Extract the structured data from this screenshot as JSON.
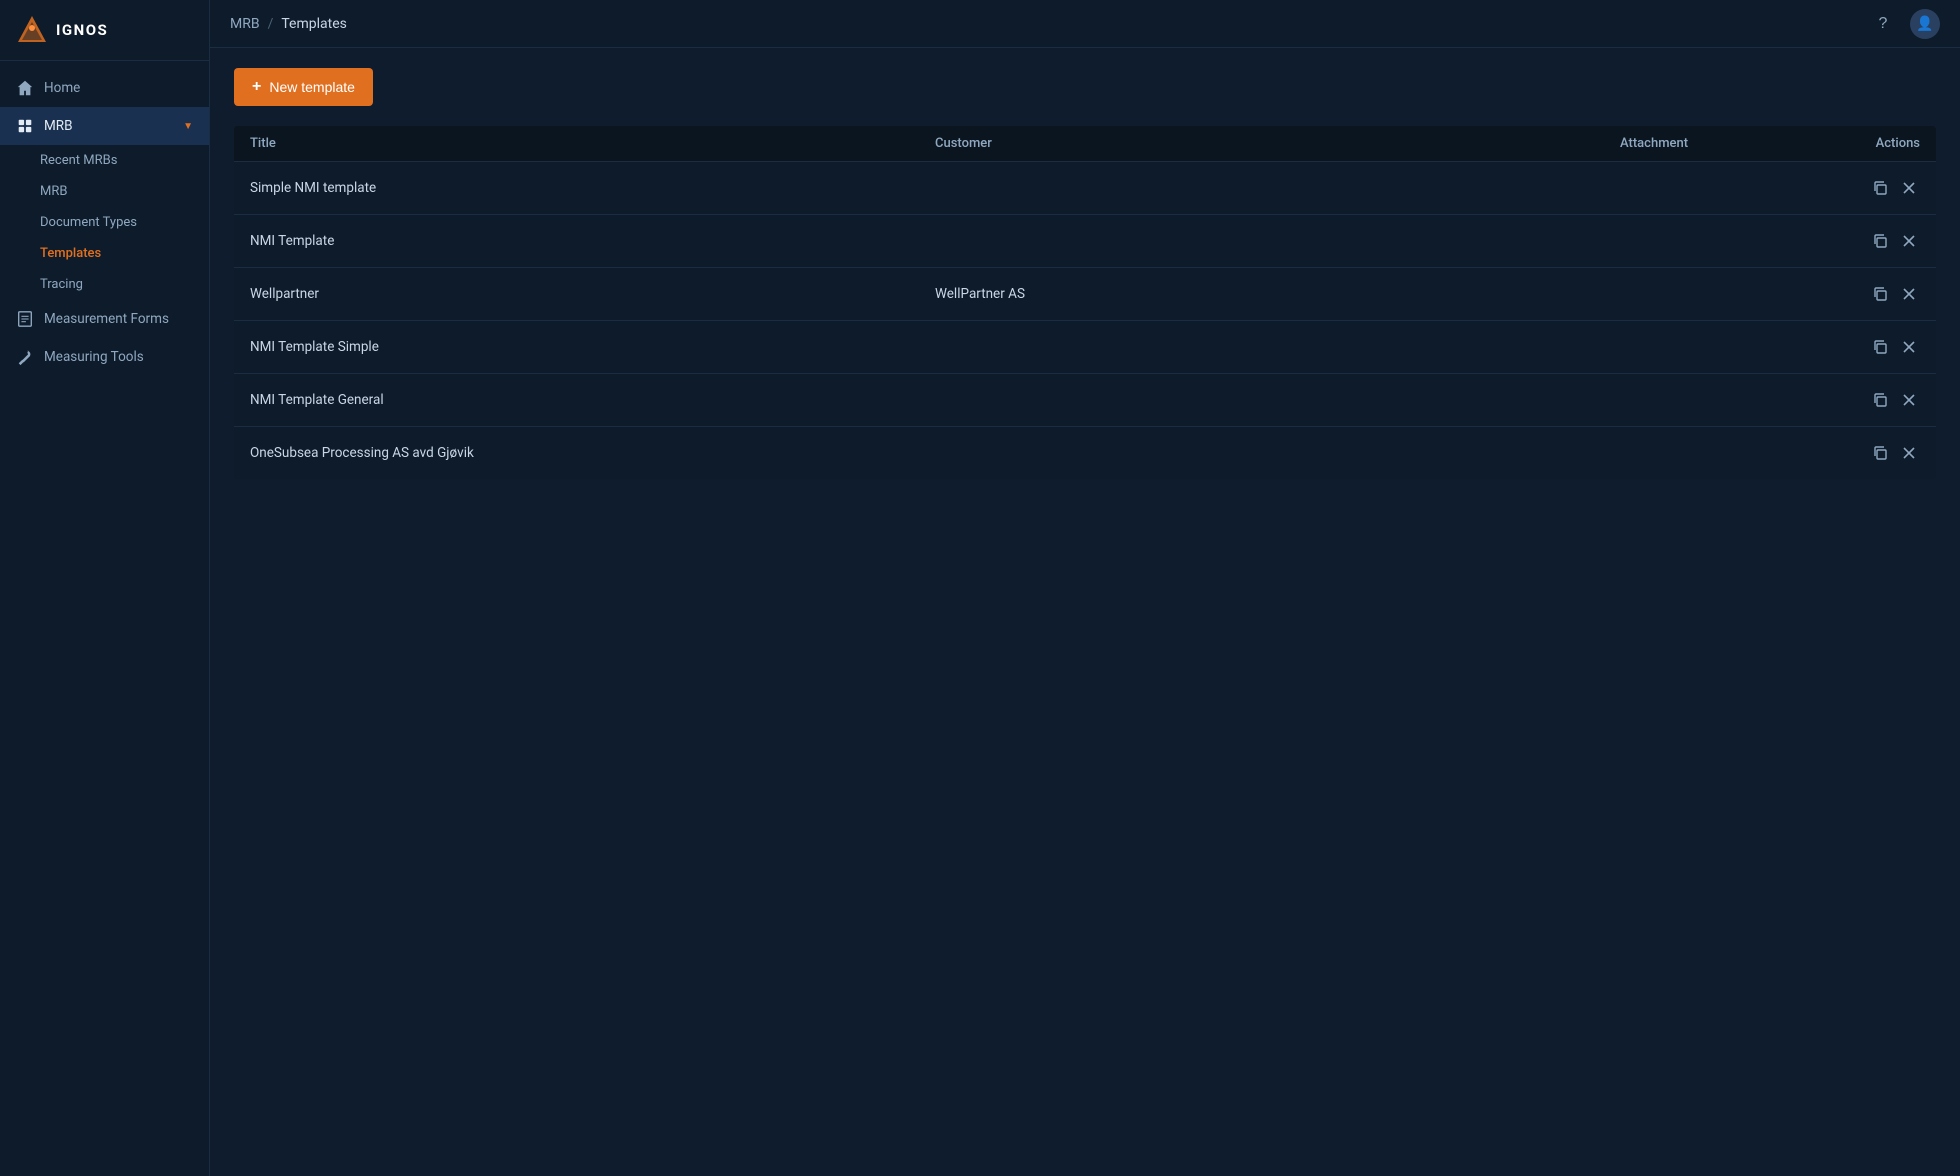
{
  "app": {
    "name": "IGNOS"
  },
  "breadcrumb": {
    "parent": "MRB",
    "separator": "/",
    "current": "Templates"
  },
  "sidebar": {
    "nav_items": [
      {
        "id": "home",
        "label": "Home",
        "icon": "home",
        "active": false
      },
      {
        "id": "mrb",
        "label": "MRB",
        "icon": "mrb",
        "active": true,
        "expanded": true
      },
      {
        "id": "measurement-forms",
        "label": "Measurement Forms",
        "icon": "forms",
        "active": false
      },
      {
        "id": "measuring-tools",
        "label": "Measuring Tools",
        "icon": "tools",
        "active": false
      }
    ],
    "mrb_sub_items": [
      {
        "id": "recent-mrbs",
        "label": "Recent MRBs"
      },
      {
        "id": "mrb",
        "label": "MRB"
      },
      {
        "id": "document-types",
        "label": "Document Types"
      },
      {
        "id": "templates",
        "label": "Templates",
        "active": true
      },
      {
        "id": "tracing",
        "label": "Tracing"
      }
    ]
  },
  "toolbar": {
    "new_template_label": "New template"
  },
  "table": {
    "columns": [
      {
        "id": "title",
        "label": "Title"
      },
      {
        "id": "customer",
        "label": "Customer"
      },
      {
        "id": "attachment",
        "label": "Attachment"
      },
      {
        "id": "actions",
        "label": "Actions"
      }
    ],
    "rows": [
      {
        "id": 1,
        "title": "Simple NMI template",
        "customer": "",
        "attachment": ""
      },
      {
        "id": 2,
        "title": "NMI Template",
        "customer": "",
        "attachment": ""
      },
      {
        "id": 3,
        "title": "Wellpartner",
        "customer": "WellPartner AS",
        "attachment": ""
      },
      {
        "id": 4,
        "title": "NMI Template Simple",
        "customer": "",
        "attachment": ""
      },
      {
        "id": 5,
        "title": "NMI Template General",
        "customer": "",
        "attachment": ""
      },
      {
        "id": 6,
        "title": "OneSubsea Processing AS avd Gjøvik",
        "customer": "",
        "attachment": ""
      }
    ]
  },
  "colors": {
    "accent": "#e07020",
    "bg_dark": "#0d1b2a",
    "bg_main": "#0f1c2e"
  }
}
